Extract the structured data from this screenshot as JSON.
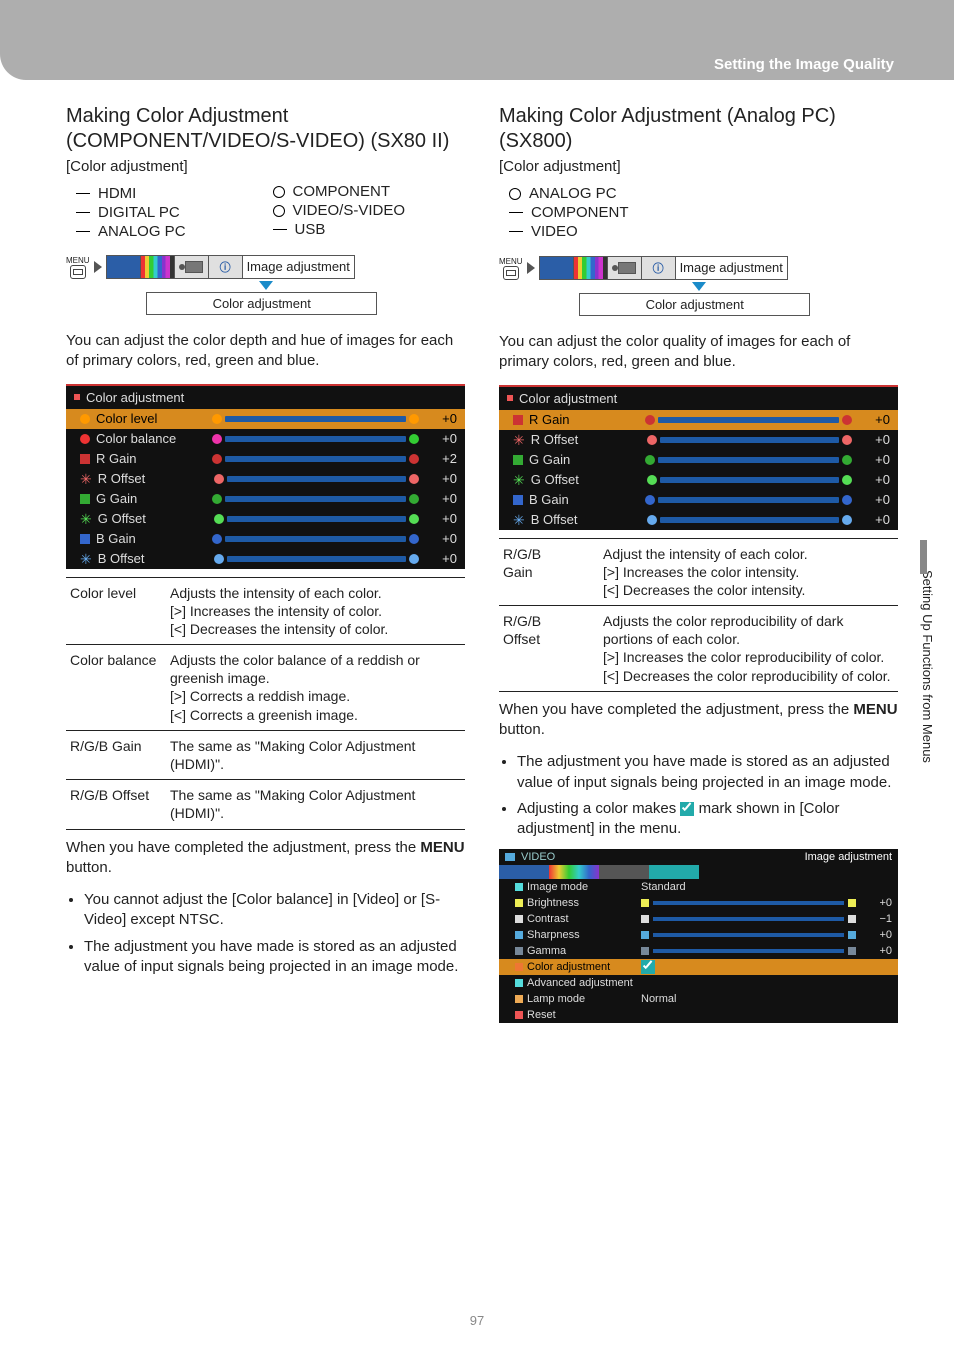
{
  "header": {
    "title": "Setting the Image Quality"
  },
  "sidetab": "Setting Up Functions from Menus",
  "pagenum": "97",
  "left": {
    "h2": "Making Color Adjustment (COMPONENT/VIDEO/S-VIDEO) (SX80 II)",
    "sub": "[Color adjustment]",
    "inputs": [
      {
        "mark": "dash",
        "label": "HDMI"
      },
      {
        "mark": "dash",
        "label": "DIGITAL PC"
      },
      {
        "mark": "dash",
        "label": "ANALOG PC"
      },
      {
        "mark": "circ",
        "label": "COMPONENT"
      },
      {
        "mark": "circ",
        "label": "VIDEO/S-VIDEO"
      },
      {
        "mark": "dash",
        "label": "USB"
      }
    ],
    "menu": {
      "tablabel": "Image adjustment",
      "sublabel": "Color adjustment",
      "menulabel": "MENU"
    },
    "intro": "You can adjust the color depth and hue of images for each of primary colors, red, green and blue.",
    "osd": {
      "title": "Color adjustment",
      "rows": [
        {
          "sel": true,
          "icon": "circ",
          "iconColor": "#f90",
          "label": "Color level",
          "left": "#f90",
          "right": "#f90",
          "val": "+0"
        },
        {
          "icon": "circ",
          "iconColor": "#e33",
          "label": "Color balance",
          "left": "#e3a",
          "right": "#3c3",
          "val": "+0"
        },
        {
          "icon": "blk",
          "iconColor": "#c33",
          "label": "R Gain",
          "left": "#c33",
          "right": "#c33",
          "val": "+2"
        },
        {
          "icon": "ast",
          "iconColor": "#e66",
          "label": "R Offset",
          "left": "#e66",
          "right": "#e66",
          "val": "+0"
        },
        {
          "icon": "blk",
          "iconColor": "#3a3",
          "label": "G Gain",
          "left": "#3a3",
          "right": "#3a3",
          "val": "+0"
        },
        {
          "icon": "ast",
          "iconColor": "#5d5",
          "label": "G Offset",
          "left": "#5d5",
          "right": "#5d5",
          "val": "+0"
        },
        {
          "icon": "blk",
          "iconColor": "#36c",
          "label": "B Gain",
          "left": "#36c",
          "right": "#36c",
          "val": "+0"
        },
        {
          "icon": "ast",
          "iconColor": "#6ae",
          "label": "B Offset",
          "left": "#6ae",
          "right": "#6ae",
          "val": "+0"
        }
      ]
    },
    "defs": [
      {
        "term": "Color level",
        "desc": "Adjusts the intensity of each color.\n[>]  Increases the intensity of color.\n[<]  Decreases the intensity of color."
      },
      {
        "term": "Color balance",
        "desc": "Adjusts the color balance of a reddish or greenish image.\n[>]  Corrects a reddish image.\n[<]  Corrects a greenish image."
      },
      {
        "term": "R/G/B Gain",
        "desc": "The same as \"Making Color Adjustment (HDMI)\"."
      },
      {
        "term": "R/G/B Offset",
        "desc": "The same as \"Making Color Adjustment (HDMI)\"."
      }
    ],
    "done_a": "When you have completed the adjustment, press the ",
    "done_menu": "MENU",
    "done_b": " button.",
    "bullets": [
      "You cannot adjust the [Color balance] in [Video] or [S-Video] except NTSC.",
      "The adjustment you have made is stored as an adjusted value of input signals being projected in an image mode."
    ]
  },
  "right": {
    "h2": "Making Color Adjustment (Analog PC) (SX800)",
    "sub": "[Color adjustment]",
    "inputs": [
      {
        "mark": "circ",
        "label": "ANALOG PC"
      },
      {
        "mark": "dash",
        "label": "COMPONENT"
      },
      {
        "mark": "dash",
        "label": "VIDEO"
      }
    ],
    "menu": {
      "tablabel": "Image adjustment",
      "sublabel": "Color adjustment",
      "menulabel": "MENU"
    },
    "intro": "You can adjust the color quality of images for each of primary colors, red, green and blue.",
    "osd": {
      "title": "Color adjustment",
      "rows": [
        {
          "sel": true,
          "icon": "blk",
          "iconColor": "#c33",
          "label": "R Gain",
          "left": "#c33",
          "right": "#c33",
          "val": "+0"
        },
        {
          "icon": "ast",
          "iconColor": "#e66",
          "label": "R Offset",
          "left": "#e66",
          "right": "#e66",
          "val": "+0"
        },
        {
          "icon": "blk",
          "iconColor": "#3a3",
          "label": "G Gain",
          "left": "#3a3",
          "right": "#3a3",
          "val": "+0"
        },
        {
          "icon": "ast",
          "iconColor": "#5d5",
          "label": "G Offset",
          "left": "#5d5",
          "right": "#5d5",
          "val": "+0"
        },
        {
          "icon": "blk",
          "iconColor": "#36c",
          "label": "B Gain",
          "left": "#36c",
          "right": "#36c",
          "val": "+0"
        },
        {
          "icon": "ast",
          "iconColor": "#6ae",
          "label": "B Offset",
          "left": "#6ae",
          "right": "#6ae",
          "val": "+0"
        }
      ]
    },
    "defs": [
      {
        "term": "R/G/B\nGain",
        "desc": "Adjust the intensity of each color.\n[>]  Increases the color intensity.\n[<]  Decreases the color intensity."
      },
      {
        "term": "R/G/B\nOffset",
        "desc": "Adjusts the color reproducibility of dark portions of each color.\n[>]  Increases the color reproducibility of color.\n[<]  Decreases the color reproducibility of color."
      }
    ],
    "done_a": "When you have completed the adjustment, press the ",
    "done_menu": "MENU",
    "done_b": " button.",
    "bullets_a": "The adjustment you have made is stored as an adjusted value of input signals being projected in an image mode.",
    "bullets_b_pre": "Adjusting a color makes ",
    "bullets_b_post": " mark shown in [Color adjustment] in the menu.",
    "osd2": {
      "top": "VIDEO",
      "tablabel": "Image adjustment",
      "rows": [
        {
          "ic": "#5dd",
          "l": "Image mode",
          "v": "Standard"
        },
        {
          "ic": "#ee5",
          "l": "Brightness",
          "bar": true,
          "li": "#ee5",
          "ri": "#ee5",
          "v": "+0"
        },
        {
          "ic": "#ddd",
          "l": "Contrast",
          "bar": true,
          "li": "#ddd",
          "ri": "#ddd",
          "v": "−1"
        },
        {
          "ic": "#5ad",
          "l": "Sharpness",
          "bar": true,
          "li": "#5ad",
          "ri": "#5ad",
          "v": "+0"
        },
        {
          "ic": "#789",
          "l": "Gamma",
          "bar": true,
          "li": "#789",
          "ri": "#789",
          "v": "+0"
        },
        {
          "sel": true,
          "ic": "#e73",
          "l": "Color adjustment",
          "chk": true
        },
        {
          "ic": "#5dd",
          "l": "Advanced adjustment"
        },
        {
          "ic": "#ea5",
          "l": "Lamp mode",
          "v": "Normal"
        },
        {
          "ic": "#e55",
          "l": "Reset"
        }
      ]
    }
  }
}
